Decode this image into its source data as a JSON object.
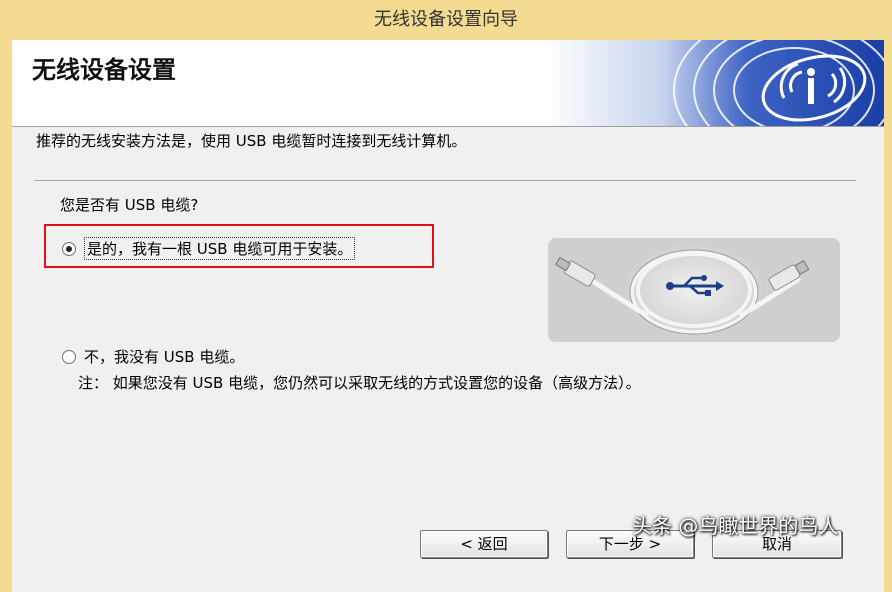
{
  "window": {
    "title": "无线设备设置向导"
  },
  "header": {
    "title": "无线设备设置"
  },
  "intro_text": "推荐的无线安装方法是，使用 USB 电缆暂时连接到无线计算机。",
  "question": "您是否有 USB 电缆?",
  "options": [
    {
      "label": "是的，我有一根 USB 电缆可用于安装。",
      "selected": true
    },
    {
      "label": "不，我没有 USB 电缆。",
      "selected": false
    }
  ],
  "note": "注：  如果您没有 USB 电缆，您仍然可以采取无线的方式设置您的设备（高级方法）。",
  "buttons": {
    "back": "< 返回",
    "next": "下一步 >",
    "cancel": "取消"
  },
  "watermark": "头条 @鸟瞰世界的鸟人",
  "colors": {
    "frame": "#f3dc91",
    "banner_blue": "#1a3fa8",
    "highlight_border": "#e0101a"
  },
  "icons": [
    "wireless-logo-icon",
    "usb-cable-icon",
    "usb-symbol-icon"
  ]
}
